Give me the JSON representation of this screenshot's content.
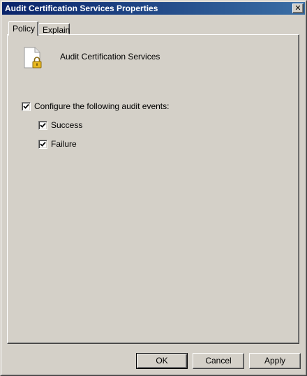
{
  "window": {
    "title": "Audit Certification Services Properties",
    "close_glyph": "✕"
  },
  "tabs": [
    {
      "label": "Policy",
      "active": true
    },
    {
      "label": "Explain",
      "active": false
    }
  ],
  "policy": {
    "name": "Audit Certification Services",
    "icon": "policy-document-lock-icon",
    "configure": {
      "label": "Configure the following audit events:",
      "checked": true
    },
    "options": [
      {
        "label": "Success",
        "checked": true
      },
      {
        "label": "Failure",
        "checked": true
      }
    ]
  },
  "buttons": {
    "ok": "OK",
    "cancel": "Cancel",
    "apply": "Apply"
  },
  "colors": {
    "titlebar_start": "#0a246a",
    "titlebar_end": "#3a6ea5",
    "face": "#d4d0c8"
  }
}
